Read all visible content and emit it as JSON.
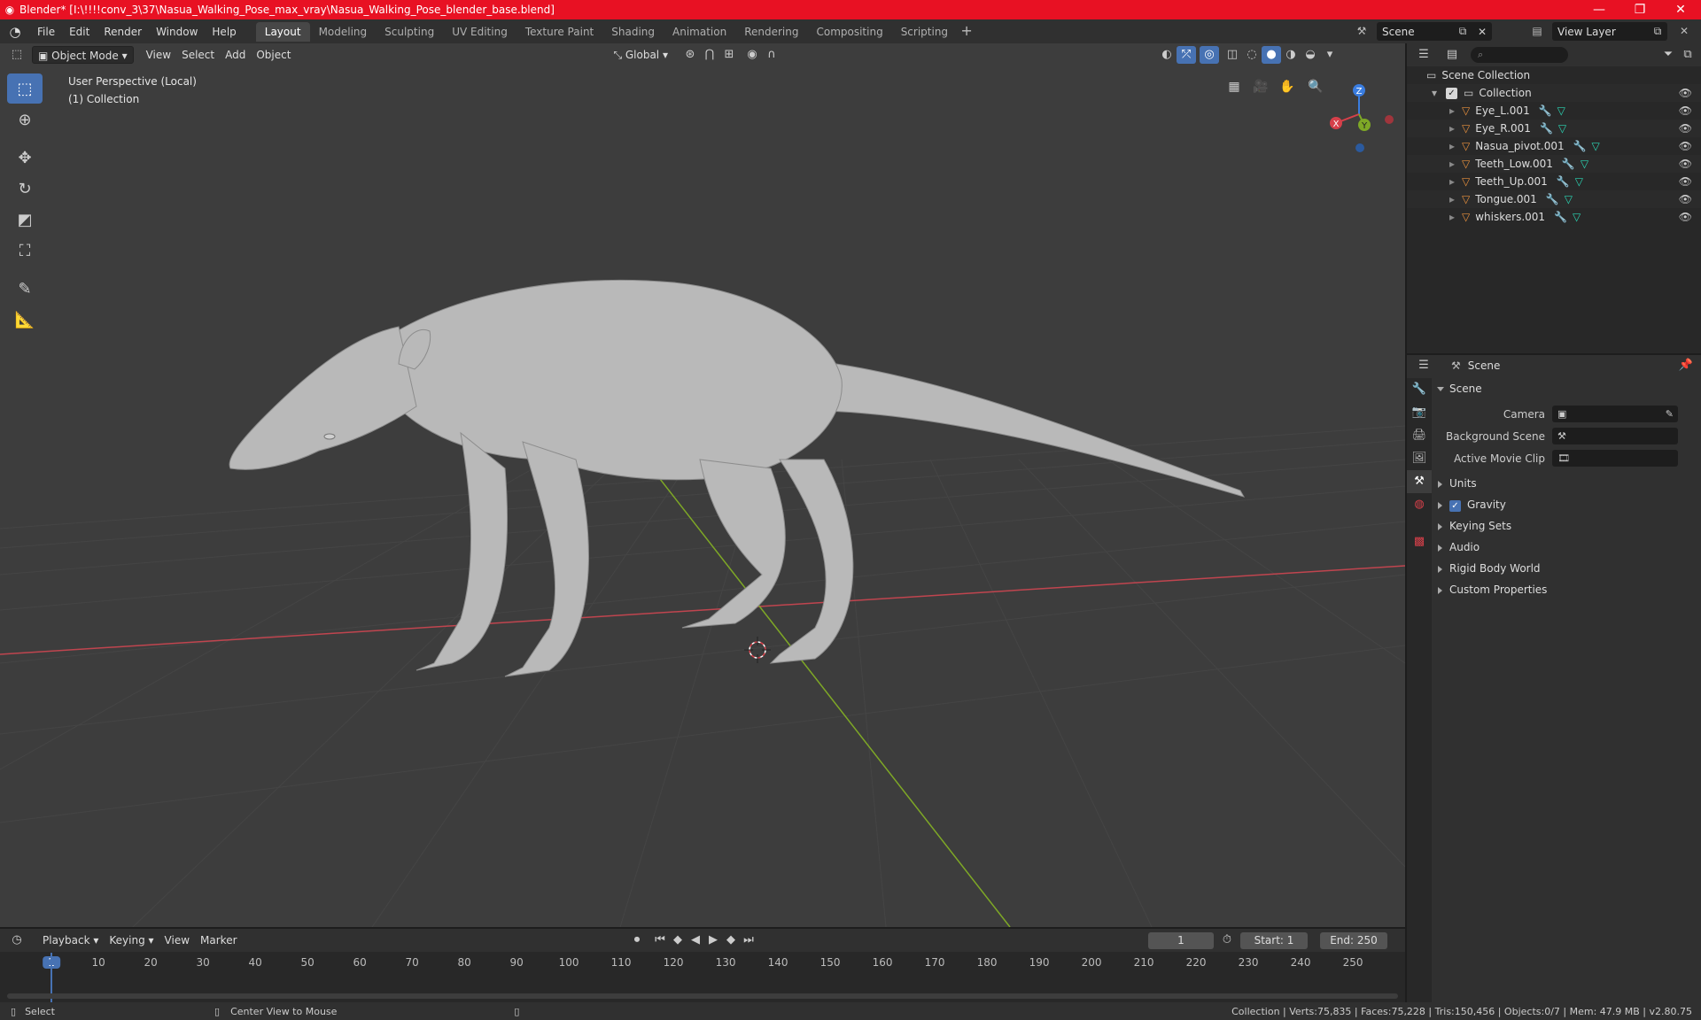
{
  "titlebar": {
    "title": "Blender* [I:\\!!!!conv_3\\37\\Nasua_Walking_Pose_max_vray\\Nasua_Walking_Pose_blender_base.blend]",
    "minimize": "—",
    "maximize": "❐",
    "close": "✕"
  },
  "menu": [
    "File",
    "Edit",
    "Render",
    "Window",
    "Help"
  ],
  "workspaces": [
    "Layout",
    "Modeling",
    "Sculpting",
    "UV Editing",
    "Texture Paint",
    "Shading",
    "Animation",
    "Rendering",
    "Compositing",
    "Scripting"
  ],
  "workspace_add": "+",
  "scene_selector": "Scene",
  "view_layer_selector": "View Layer",
  "viewport": {
    "mode": "Object Mode",
    "menus": [
      "View",
      "Select",
      "Add",
      "Object"
    ],
    "transform_orientation": "Global",
    "perspective_label": "User Perspective (Local)",
    "collection_label": "(1) Collection",
    "gizmo": {
      "x": "X",
      "y": "Y",
      "z": "Z"
    }
  },
  "outliner": {
    "search_placeholder": "",
    "root": "Scene Collection",
    "collection": "Collection",
    "objects": [
      "Eye_L.001",
      "Eye_R.001",
      "Nasua_pivot.001",
      "Teeth_Low.001",
      "Teeth_Up.001",
      "Tongue.001",
      "whiskers.001"
    ]
  },
  "properties": {
    "context": "Scene",
    "panel": "Scene",
    "fields": [
      {
        "label": "Camera",
        "value": ""
      },
      {
        "label": "Background Scene",
        "value": ""
      },
      {
        "label": "Active Movie Clip",
        "value": ""
      }
    ],
    "subpanels": [
      "Units",
      "Gravity",
      "Keying Sets",
      "Audio",
      "Rigid Body World",
      "Custom Properties"
    ],
    "gravity_checked": true
  },
  "timeline": {
    "menus": [
      "Playback",
      "Keying",
      "View",
      "Marker"
    ],
    "current_frame": "1",
    "start_label": "Start:",
    "start": "1",
    "end_label": "End:",
    "end": "250",
    "ruler": [
      "1",
      "10",
      "20",
      "30",
      "40",
      "50",
      "60",
      "70",
      "80",
      "90",
      "100",
      "110",
      "120",
      "130",
      "140",
      "150",
      "160",
      "170",
      "180",
      "190",
      "200",
      "210",
      "220",
      "230",
      "240",
      "250"
    ]
  },
  "statusbar": {
    "left_action": "Select",
    "middle_action": "Center View to Mouse",
    "stats": "Collection | Verts:75,835 | Faces:75,228 | Tris:150,456 | Objects:0/7 | Mem: 47.9 MB | v2.80.75"
  },
  "colors": {
    "accent": "#4772b3",
    "titlebar": "#e81123",
    "x_axis": "#d6404a",
    "y_axis": "#7ea826",
    "z_axis": "#3a7de0",
    "object_icon": "#e8903d",
    "mesh_icon": "#2bd6b4"
  }
}
